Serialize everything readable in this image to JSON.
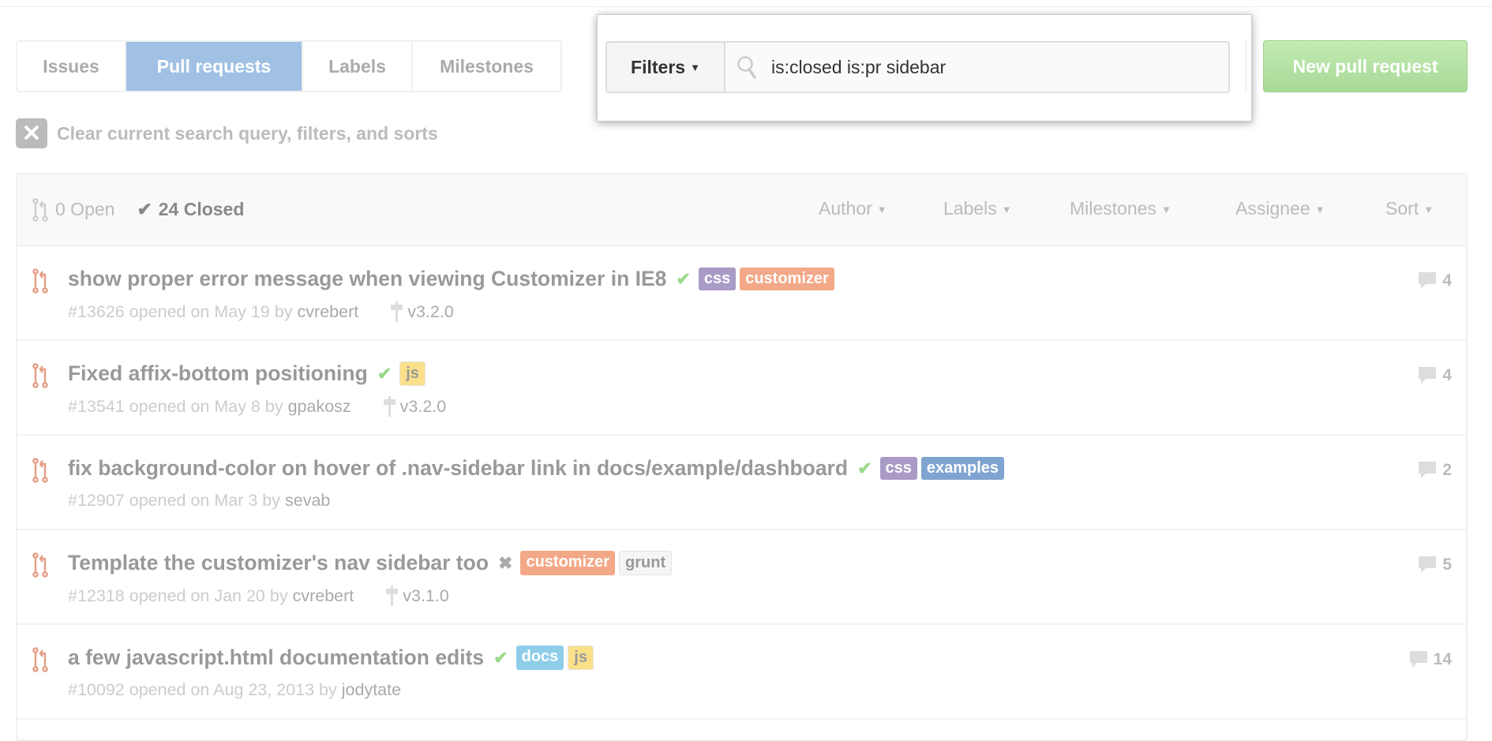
{
  "tabs": [
    {
      "label": "Issues"
    },
    {
      "label": "Pull requests",
      "active": true
    },
    {
      "label": "Labels"
    },
    {
      "label": "Milestones"
    }
  ],
  "filters": {
    "label": "Filters",
    "search_value": "is:closed is:pr sidebar"
  },
  "new_pr_label": "New pull request",
  "clear_label": "Clear current search query, filters, and sorts",
  "header": {
    "open": "0 Open",
    "closed": "24 Closed",
    "filters": [
      "Author",
      "Labels",
      "Milestones",
      "Assignee",
      "Sort"
    ]
  },
  "colors": {
    "accent_tab": "#a1c1e4",
    "new_pr": "#a8d997",
    "pr_icon": "#e59d85",
    "status_ok": "#9bd88b"
  },
  "rows": [
    {
      "title": "show proper error message when viewing Customizer in IE8",
      "status": "success",
      "labels": [
        {
          "name": "css",
          "color": "#a99bc6"
        },
        {
          "name": "customizer",
          "color": "#f3a887"
        }
      ],
      "number": "#13626",
      "opened": "opened on May 19 by",
      "author": "cvrebert",
      "milestone": "v3.2.0",
      "comments": "4"
    },
    {
      "title": "Fixed affix-bottom positioning",
      "status": "success",
      "labels": [
        {
          "name": "js",
          "color": "#fbe08a",
          "text": "#999"
        }
      ],
      "number": "#13541",
      "opened": "opened on May 8 by",
      "author": "gpakosz",
      "milestone": "v3.2.0",
      "comments": "4"
    },
    {
      "title": "fix background-color on hover of .nav-sidebar link in docs/example/dashboard",
      "status": "success",
      "labels": [
        {
          "name": "css",
          "color": "#a99bc6"
        },
        {
          "name": "examples",
          "color": "#7fa4d1"
        }
      ],
      "number": "#12907",
      "opened": "opened on Mar 3 by",
      "author": "sevab",
      "milestone": "",
      "comments": "2"
    },
    {
      "title": "Template the customizer's nav sidebar too",
      "status": "failure",
      "labels": [
        {
          "name": "customizer",
          "color": "#f3a887"
        },
        {
          "name": "grunt",
          "color": "#f5f5f5",
          "text": "#999"
        }
      ],
      "number": "#12318",
      "opened": "opened on Jan 20 by",
      "author": "cvrebert",
      "milestone": "v3.1.0",
      "comments": "5"
    },
    {
      "title": "a few javascript.html documentation edits",
      "status": "success",
      "labels": [
        {
          "name": "docs",
          "color": "#8ecdea"
        },
        {
          "name": "js",
          "color": "#fbe08a",
          "text": "#999"
        }
      ],
      "number": "#10092",
      "opened": "opened on Aug 23, 2013 by",
      "author": "jodytate",
      "milestone": "",
      "comments": "14"
    }
  ]
}
